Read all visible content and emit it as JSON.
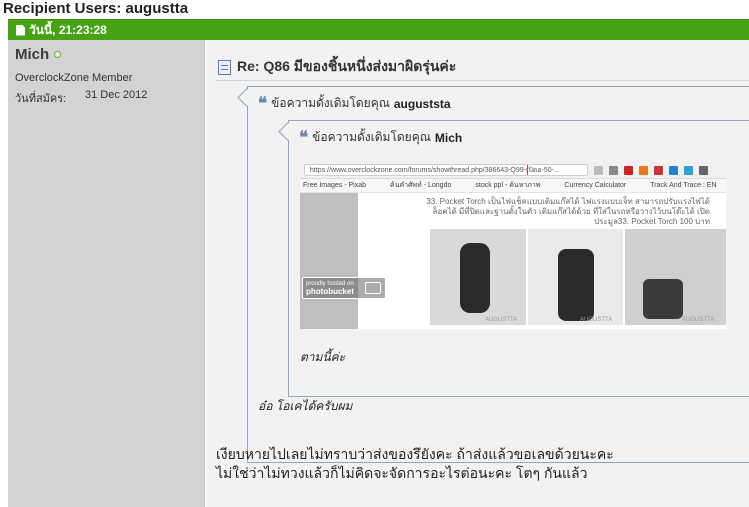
{
  "recipient": {
    "label": "Recipient Users:",
    "user": "augustta"
  },
  "post": {
    "date": "วันนี้, 21:23:28",
    "title": "Re: Q86 มีของชิ้นหนึ่งส่งมาผิดรุ่นค่ะ",
    "body_lines": [
      "เงียบหายไปเลยไม่ทราบว่าส่งของรึยังคะ ถ้าส่งแล้วขอเลขด้วยนะคะ",
      "ไม่ใช่ว่าไม่ทวงแล้วก็ไม่คิดจะจัดการอะไรต่อนะคะ โตๆ กันแล้ว"
    ]
  },
  "author": {
    "name": "Mich",
    "title": "OverclockZone Member",
    "join_label": "วันที่สมัคร:",
    "join_date": "31 Dec 2012"
  },
  "quote_outer": {
    "prefix": "ข้อความดั้งเดิมโดยคุณ",
    "author": "auguststa",
    "text": "อ๋อ โอเคได้ครับผม"
  },
  "quote_inner": {
    "prefix": "ข้อความดั้งเดิมโดยคุณ",
    "author": "Mich",
    "text": "ตามนี้ค่ะ"
  },
  "screenshot": {
    "url": "https://www.overclockzone.com/forums/showthread.php/386643-Q99-เปิดอ-50-...",
    "bookmarks": [
      "Free Images - Pixab",
      "ค้นคำศัพท์ - Longdo",
      "stock ppl - ค้นหาภาพ",
      "Currency Calculator",
      "Track And Trace : EN"
    ],
    "caption": "33. Pocket Torch เป็นไฟแช็คแบบเติมแก๊สได้ ไฟแรงแบบเจ็ท สามารถปรับแรงไฟได้ ล็อคได้ มีที่ปิดและฐานตั้งในตัว เติมแก๊สได้ด้วย ที่ใส่ในรถหรือวางไว้บนโต๊ะได้ เปิดประมูล33. Pocket Torch 100 บาท",
    "photobucket_small": "proudly hosted on",
    "photobucket_big": "photobucket",
    "watermarks": [
      "AUGUSTTA",
      "AUGUSTTA",
      "AUGUSTTA"
    ]
  },
  "icons": {
    "doc": "document-icon",
    "online": "online-status-icon",
    "title": "post-icon",
    "quote": "quote-icon"
  },
  "colors": {
    "header_bg": "#45a314",
    "quote_border": "#8ba6c9",
    "sidebar_bg": "#d3d3d3"
  }
}
